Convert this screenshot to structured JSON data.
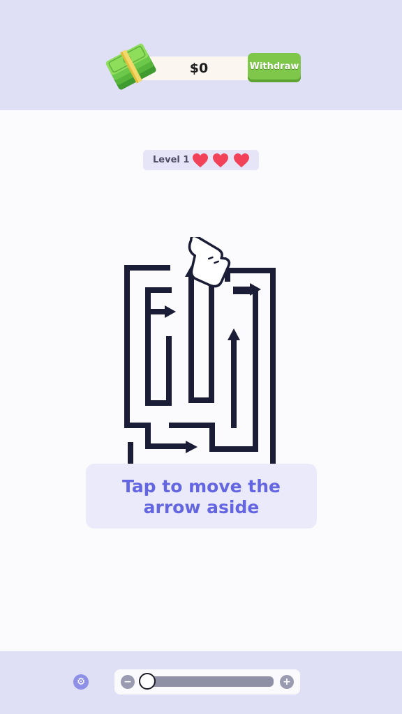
{
  "header": {
    "balance": "$0",
    "withdraw_label": "Withdraw",
    "money_icon": "cash-stack-icon",
    "accent_green": "#7fc74a"
  },
  "level": {
    "label": "Level 1",
    "lives": 3,
    "heart_color": "#f2425a"
  },
  "hint": {
    "text": "Tap to move the arrow aside"
  },
  "toolbar": {
    "settings_icon": "gear-icon",
    "zoom_out_label": "−",
    "zoom_in_label": "+",
    "zoom_level": 0
  },
  "colors": {
    "panel_background": "#dfdff5",
    "maze_line": "#1b1c36",
    "hint_text": "#6366e0"
  }
}
